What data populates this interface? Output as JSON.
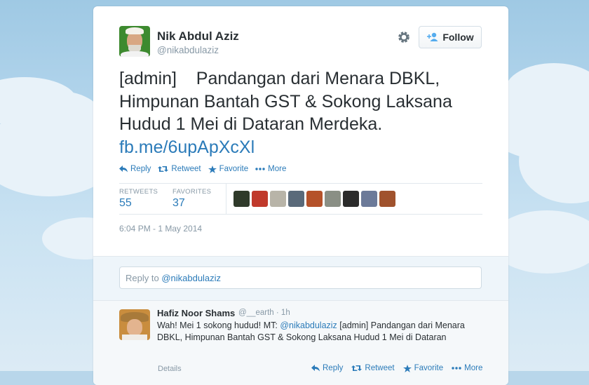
{
  "tweet": {
    "author_name": "Nik Abdul Aziz",
    "author_handle": "@nikabdulaziz",
    "follow_label": "Follow",
    "text": "[admin]    Pandangan dari Menara DBKL, Himpunan Bantah GST & Sokong Laksana Hudud 1 Mei di Dataran Merdeka.",
    "link": "fb.me/6upApXcXl",
    "actions": {
      "reply": "Reply",
      "retweet": "Retweet",
      "favorite": "Favorite",
      "more": "More"
    },
    "stats": {
      "retweets_label": "RETWEETS",
      "retweets": "55",
      "favorites_label": "FAVORITES",
      "favorites": "37"
    },
    "timestamp": "6:04 PM - 1 May 2014"
  },
  "reply_box": {
    "prefix": "Reply to ",
    "mention": "@nikabdulaziz"
  },
  "reply_tweet": {
    "author_name": "Hafiz Noor Shams",
    "author_handle": "@__earth",
    "time": "1h",
    "text_prefix": "Wah! Mei 1 sokong hudud! MT: ",
    "mention": "@nikabdulaziz",
    "text_suffix": " [admin] Pandangan dari Menara DBKL, Himpunan Bantah GST & Sokong Laksana Hudud 1 Mei di Dataran",
    "details": "Details",
    "actions": {
      "reply": "Reply",
      "retweet": "Retweet",
      "favorite": "Favorite",
      "more": "More"
    }
  },
  "colors": {
    "link": "#2b7bb9",
    "text": "#292f33",
    "muted": "#8899a6",
    "sky": "#b3d5ec"
  },
  "fav_avatar_colors": [
    "#2f3a2a",
    "#c0392b",
    "#b8b4a8",
    "#5a6a7a",
    "#b5522a",
    "#8a8f85",
    "#2b2b2b",
    "#6c7a99",
    "#a0522d"
  ]
}
